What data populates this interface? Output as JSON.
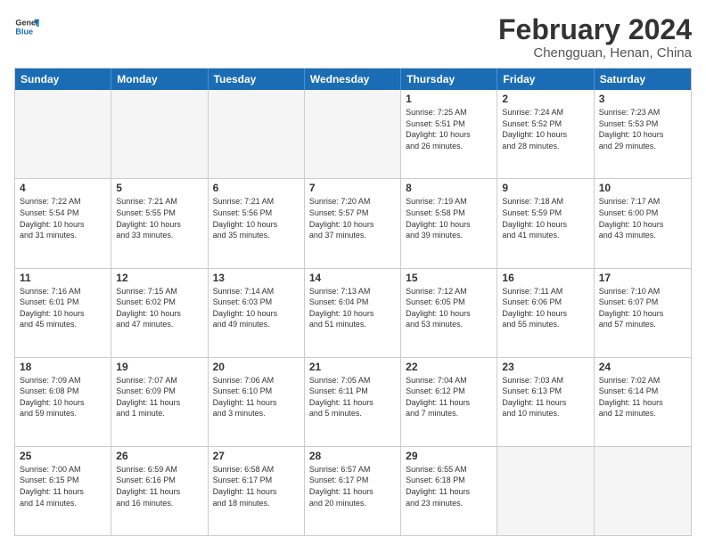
{
  "logo": {
    "line1": "General",
    "line2": "Blue"
  },
  "title": "February 2024",
  "subtitle": "Chengguan, Henan, China",
  "days": [
    "Sunday",
    "Monday",
    "Tuesday",
    "Wednesday",
    "Thursday",
    "Friday",
    "Saturday"
  ],
  "weeks": [
    [
      {
        "day": "",
        "info": ""
      },
      {
        "day": "",
        "info": ""
      },
      {
        "day": "",
        "info": ""
      },
      {
        "day": "",
        "info": ""
      },
      {
        "day": "1",
        "info": "Sunrise: 7:25 AM\nSunset: 5:51 PM\nDaylight: 10 hours\nand 26 minutes."
      },
      {
        "day": "2",
        "info": "Sunrise: 7:24 AM\nSunset: 5:52 PM\nDaylight: 10 hours\nand 28 minutes."
      },
      {
        "day": "3",
        "info": "Sunrise: 7:23 AM\nSunset: 5:53 PM\nDaylight: 10 hours\nand 29 minutes."
      }
    ],
    [
      {
        "day": "4",
        "info": "Sunrise: 7:22 AM\nSunset: 5:54 PM\nDaylight: 10 hours\nand 31 minutes."
      },
      {
        "day": "5",
        "info": "Sunrise: 7:21 AM\nSunset: 5:55 PM\nDaylight: 10 hours\nand 33 minutes."
      },
      {
        "day": "6",
        "info": "Sunrise: 7:21 AM\nSunset: 5:56 PM\nDaylight: 10 hours\nand 35 minutes."
      },
      {
        "day": "7",
        "info": "Sunrise: 7:20 AM\nSunset: 5:57 PM\nDaylight: 10 hours\nand 37 minutes."
      },
      {
        "day": "8",
        "info": "Sunrise: 7:19 AM\nSunset: 5:58 PM\nDaylight: 10 hours\nand 39 minutes."
      },
      {
        "day": "9",
        "info": "Sunrise: 7:18 AM\nSunset: 5:59 PM\nDaylight: 10 hours\nand 41 minutes."
      },
      {
        "day": "10",
        "info": "Sunrise: 7:17 AM\nSunset: 6:00 PM\nDaylight: 10 hours\nand 43 minutes."
      }
    ],
    [
      {
        "day": "11",
        "info": "Sunrise: 7:16 AM\nSunset: 6:01 PM\nDaylight: 10 hours\nand 45 minutes."
      },
      {
        "day": "12",
        "info": "Sunrise: 7:15 AM\nSunset: 6:02 PM\nDaylight: 10 hours\nand 47 minutes."
      },
      {
        "day": "13",
        "info": "Sunrise: 7:14 AM\nSunset: 6:03 PM\nDaylight: 10 hours\nand 49 minutes."
      },
      {
        "day": "14",
        "info": "Sunrise: 7:13 AM\nSunset: 6:04 PM\nDaylight: 10 hours\nand 51 minutes."
      },
      {
        "day": "15",
        "info": "Sunrise: 7:12 AM\nSunset: 6:05 PM\nDaylight: 10 hours\nand 53 minutes."
      },
      {
        "day": "16",
        "info": "Sunrise: 7:11 AM\nSunset: 6:06 PM\nDaylight: 10 hours\nand 55 minutes."
      },
      {
        "day": "17",
        "info": "Sunrise: 7:10 AM\nSunset: 6:07 PM\nDaylight: 10 hours\nand 57 minutes."
      }
    ],
    [
      {
        "day": "18",
        "info": "Sunrise: 7:09 AM\nSunset: 6:08 PM\nDaylight: 10 hours\nand 59 minutes."
      },
      {
        "day": "19",
        "info": "Sunrise: 7:07 AM\nSunset: 6:09 PM\nDaylight: 11 hours\nand 1 minute."
      },
      {
        "day": "20",
        "info": "Sunrise: 7:06 AM\nSunset: 6:10 PM\nDaylight: 11 hours\nand 3 minutes."
      },
      {
        "day": "21",
        "info": "Sunrise: 7:05 AM\nSunset: 6:11 PM\nDaylight: 11 hours\nand 5 minutes."
      },
      {
        "day": "22",
        "info": "Sunrise: 7:04 AM\nSunset: 6:12 PM\nDaylight: 11 hours\nand 7 minutes."
      },
      {
        "day": "23",
        "info": "Sunrise: 7:03 AM\nSunset: 6:13 PM\nDaylight: 11 hours\nand 10 minutes."
      },
      {
        "day": "24",
        "info": "Sunrise: 7:02 AM\nSunset: 6:14 PM\nDaylight: 11 hours\nand 12 minutes."
      }
    ],
    [
      {
        "day": "25",
        "info": "Sunrise: 7:00 AM\nSunset: 6:15 PM\nDaylight: 11 hours\nand 14 minutes."
      },
      {
        "day": "26",
        "info": "Sunrise: 6:59 AM\nSunset: 6:16 PM\nDaylight: 11 hours\nand 16 minutes."
      },
      {
        "day": "27",
        "info": "Sunrise: 6:58 AM\nSunset: 6:17 PM\nDaylight: 11 hours\nand 18 minutes."
      },
      {
        "day": "28",
        "info": "Sunrise: 6:57 AM\nSunset: 6:17 PM\nDaylight: 11 hours\nand 20 minutes."
      },
      {
        "day": "29",
        "info": "Sunrise: 6:55 AM\nSunset: 6:18 PM\nDaylight: 11 hours\nand 23 minutes."
      },
      {
        "day": "",
        "info": ""
      },
      {
        "day": "",
        "info": ""
      }
    ]
  ]
}
